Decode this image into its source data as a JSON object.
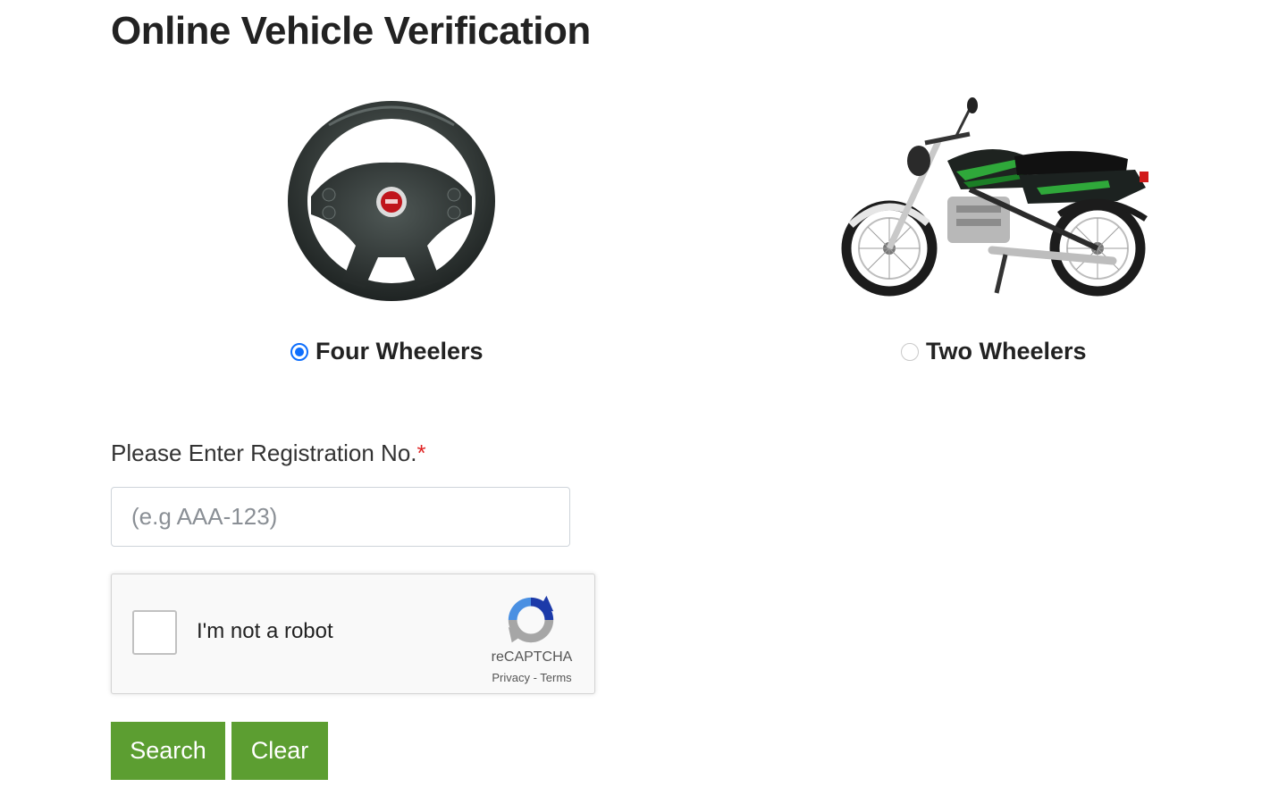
{
  "page": {
    "title": "Online Vehicle Verification"
  },
  "vehicle_types": [
    {
      "label": "Four Wheelers",
      "selected": true,
      "icon": "steering-wheel-icon"
    },
    {
      "label": "Two Wheelers",
      "selected": false,
      "icon": "motorcycle-icon"
    }
  ],
  "form": {
    "reg_label": "Please Enter Registration No.",
    "required_mark": "*",
    "reg_placeholder": "(e.g AAA-123)",
    "reg_value": ""
  },
  "recaptcha": {
    "prompt": "I'm not a robot",
    "brand": "reCAPTCHA",
    "privacy": "Privacy",
    "separator": " - ",
    "terms": "Terms",
    "checked": false
  },
  "buttons": {
    "search": "Search",
    "clear": "Clear"
  },
  "colors": {
    "accent_green": "#5c9e31",
    "radio_blue": "#0d6efd",
    "required_red": "#e02424"
  }
}
